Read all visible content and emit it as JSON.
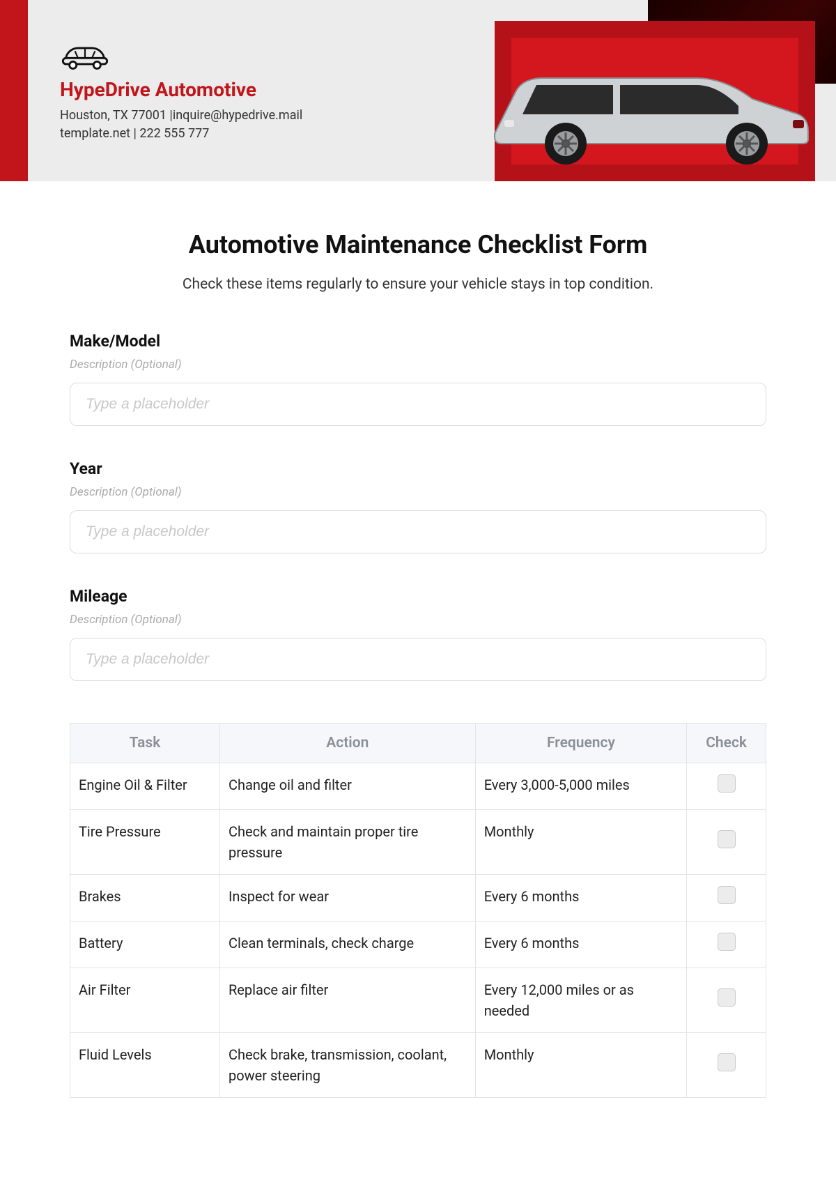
{
  "header": {
    "company_name": "HypeDrive Automotive",
    "contact_line1": "Houston, TX 77001 |inquire@hypedrive.mail",
    "contact_line2": "template.net | 222 555 777"
  },
  "page": {
    "title": "Automotive Maintenance Checklist Form",
    "subtitle": "Check these items regularly to ensure your vehicle stays in top condition."
  },
  "fields": [
    {
      "label": "Make/Model",
      "description": "Description (Optional)",
      "placeholder": "Type a placeholder",
      "value": ""
    },
    {
      "label": "Year",
      "description": "Description (Optional)",
      "placeholder": "Type a placeholder",
      "value": ""
    },
    {
      "label": "Mileage",
      "description": "Description (Optional)",
      "placeholder": "Type a placeholder",
      "value": ""
    }
  ],
  "table": {
    "headers": {
      "task": "Task",
      "action": "Action",
      "frequency": "Frequency",
      "check": "Check"
    },
    "rows": [
      {
        "task": "Engine Oil & Filter",
        "action": "Change oil and filter",
        "frequency": "Every 3,000-5,000 miles",
        "checked": false
      },
      {
        "task": "Tire Pressure",
        "action": "Check and maintain proper tire pressure",
        "frequency": "Monthly",
        "checked": false
      },
      {
        "task": "Brakes",
        "action": "Inspect for wear",
        "frequency": "Every 6 months",
        "checked": false
      },
      {
        "task": "Battery",
        "action": "Clean terminals, check charge",
        "frequency": "Every 6 months",
        "checked": false
      },
      {
        "task": "Air Filter",
        "action": "Replace air filter",
        "frequency": "Every 12,000 miles or as needed",
        "checked": false
      },
      {
        "task": "Fluid Levels",
        "action": "Check brake, transmission, coolant, power steering",
        "frequency": "Monthly",
        "checked": false
      }
    ]
  }
}
